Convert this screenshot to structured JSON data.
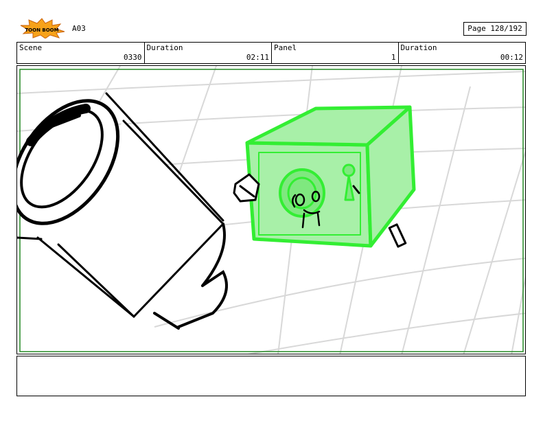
{
  "header": {
    "sequence": "A03",
    "page": "Page 128/192"
  },
  "info": {
    "scene_label": "Scene",
    "scene_value": "0330",
    "duration1_label": "Duration",
    "duration1_value": "02:11",
    "panel_label": "Panel",
    "panel_value": "1",
    "duration2_label": "Duration",
    "duration2_value": "00:12"
  },
  "logo": {
    "text": "TOON BOOM"
  },
  "colors": {
    "highlight": "#33ee33",
    "frame": "#228822"
  },
  "notes": {
    "text": ""
  }
}
